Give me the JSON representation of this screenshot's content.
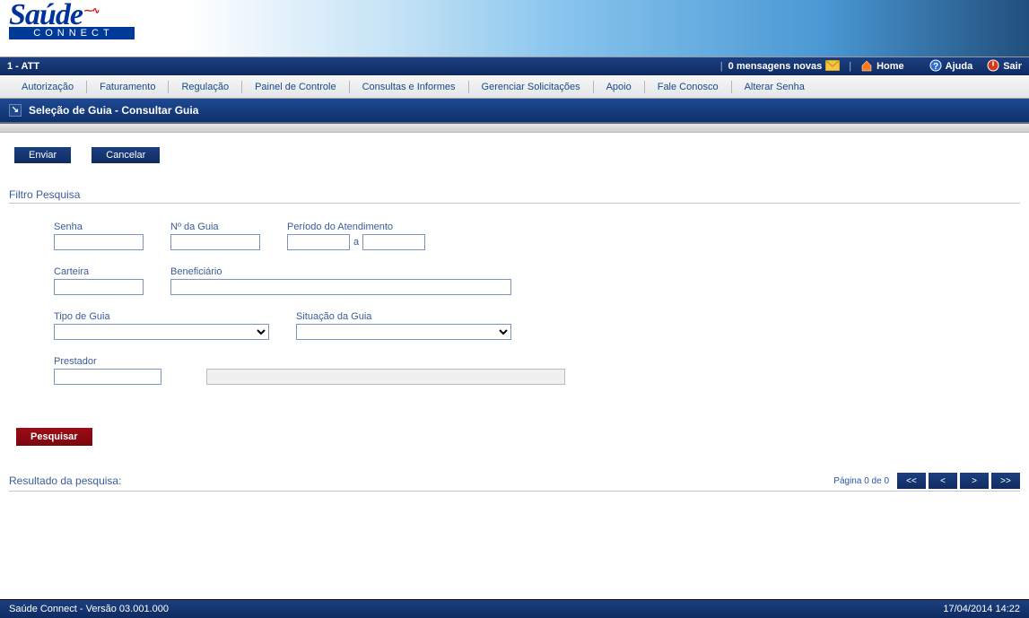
{
  "logo": {
    "top": "Saúde",
    "bottom": "CONNECT"
  },
  "topbar": {
    "left": "1 - ATT",
    "messages": "0 mensagens novas",
    "home": "Home",
    "help": "Ajuda",
    "logout": "Sair"
  },
  "menu": [
    "Autorização",
    "Faturamento",
    "Regulação",
    "Painel de Controle",
    "Consultas e Informes",
    "Gerenciar Solicitações",
    "Apoio",
    "Fale Conosco",
    "Alterar Senha"
  ],
  "breadcrumb": "Seleção de Guia - Consultar Guia",
  "buttons": {
    "send": "Enviar",
    "cancel": "Cancelar",
    "search": "Pesquisar"
  },
  "filter": {
    "title": "Filtro Pesquisa",
    "senha": "Senha",
    "numero_guia": "Nº da Guia",
    "periodo": "Período do Atendimento",
    "periodo_sep": "a",
    "carteira": "Carteira",
    "beneficiario": "Beneficiário",
    "tipo_guia": "Tipo de Guia",
    "situacao": "Situação da Guia",
    "prestador": "Prestador"
  },
  "result": {
    "title": "Resultado da pesquisa:",
    "page_info": "Página 0 de 0",
    "first": "<<",
    "prev": "<",
    "next": ">",
    "last": ">>"
  },
  "footer": {
    "version": "Saúde Connect - Versão 03.001.000",
    "datetime": "17/04/2014 14:22"
  }
}
